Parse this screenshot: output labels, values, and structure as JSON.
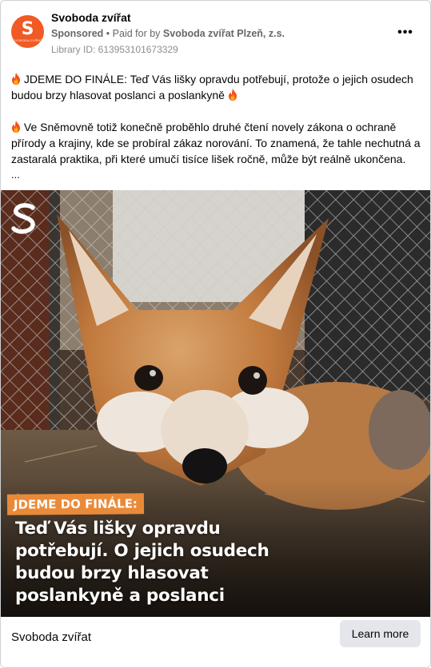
{
  "header": {
    "avatar_letter": "S",
    "avatar_caption": "SVOBODA ZVÍŘAT",
    "page_name": "Svoboda zvířat",
    "sponsored_label": "Sponsored",
    "separator": "•",
    "paid_for_label": "Paid for by",
    "paid_for_by": "Svoboda zvířat Plzeň, z.s.",
    "library_id": "Library ID: 613953101673329",
    "more_icon": "more-horizontal-icon",
    "more_label": "•••"
  },
  "body": {
    "paragraph_1": "JDEME DO FINÁLE: Teď Vás lišky opravdu potřebují, protože o jejich osudech budou brzy hlasovat poslanci a poslankyně",
    "paragraph_2": "Ve Sněmovně totiž konečně proběhlo druhé čtení novely zákona o ochraně přírody a krajiny, kde se probíral zákaz norování. To znamená, že tahle nechutná a zastaralá praktika, při které umučí tisíce lišek ročně, může být reálně ukončena.",
    "truncation": "...",
    "emoji_icon": "fire-icon"
  },
  "image": {
    "logo_icon": "svoboda-zvirat-logo",
    "tag_text": "JDEME DO FINÁLE:",
    "headline_lines": [
      "Teď Vás lišky opravdu",
      "potřebují. O jejich osudech",
      "budou brzy hlasovat",
      "poslankyně a poslanci"
    ]
  },
  "footer": {
    "advertiser_name": "Svoboda zvířat",
    "cta_label": "Learn more"
  },
  "colors": {
    "brand_orange": "#f15a24",
    "tag_orange": "#e98a39",
    "meta_gray": "#65676b",
    "button_gray": "#e4e6eb"
  }
}
